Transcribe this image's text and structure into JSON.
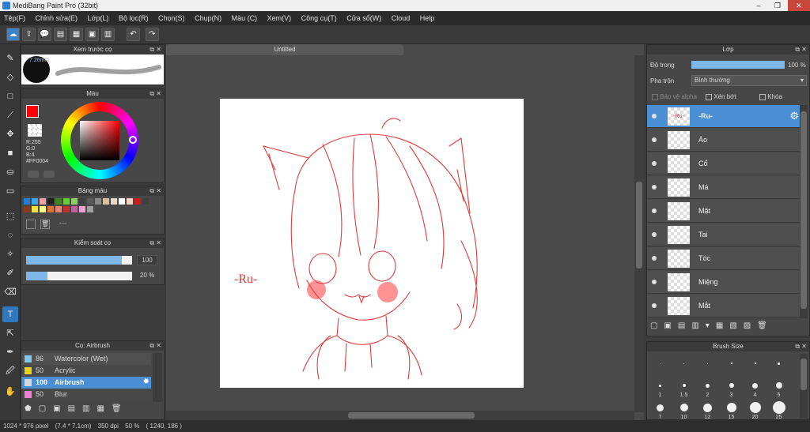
{
  "window": {
    "title": "MediBang Paint Pro (32bit)",
    "min": "–",
    "max": "❐",
    "close": "✕"
  },
  "menu": [
    "Tệp(F)",
    "Chỉnh sửa(E)",
    "Lớp(L)",
    "Bộ lọc(R)",
    "Chọn(S)",
    "Chụp(N)",
    "Màu (C)",
    "Xem(V)",
    "Công cụ(T)",
    "Cửa sổ(W)",
    "Cloud",
    "Help"
  ],
  "document": {
    "tab_title": "Untitled",
    "signature": "-Ru-"
  },
  "panels": {
    "brush_preview": {
      "title": "Xem trước cọ",
      "size_label": "7.26mm"
    },
    "color": {
      "title": "Màu",
      "r": "R:255",
      "g": "G:0",
      "b": "B:4",
      "hex": "#FF0004",
      "current": "#ff0004"
    },
    "palette": {
      "title": "Bảng màu",
      "dots": "----"
    },
    "brush_control": {
      "title": "Kiểm soát cọ",
      "size_value": "100",
      "opacity_value": "20 %",
      "size_fraction": 0.9,
      "opacity_fraction": 0.2
    },
    "brush_list": {
      "title": "Cọ: Airbrush",
      "items": [
        {
          "size": "86",
          "name": "Watercolor (Wet)",
          "color": "#7ec8f0"
        },
        {
          "size": "50",
          "name": "Acrylic",
          "color": "#e8d21c"
        },
        {
          "size": "100",
          "name": "Airbrush",
          "color": "#d8d8d8",
          "selected": true
        },
        {
          "size": "50",
          "name": "Blur",
          "color": "#f07ed8"
        }
      ]
    },
    "layers": {
      "title": "Lớp",
      "opacity_label": "Độ trong",
      "opacity_value": "100 %",
      "blend_label": "Pha trộn",
      "blend_value": "Bình thường",
      "protect_alpha": "Bảo vệ alpha",
      "clipping": "Xén bớt",
      "lock": "Khóa",
      "items": [
        {
          "name": "-Ru-",
          "selected": true
        },
        {
          "name": "Áo"
        },
        {
          "name": "Cổ"
        },
        {
          "name": "Má"
        },
        {
          "name": "Mặt"
        },
        {
          "name": "Tai"
        },
        {
          "name": "Tóc"
        },
        {
          "name": "Miệng"
        },
        {
          "name": "Mắt"
        }
      ]
    },
    "brush_size": {
      "title": "Brush Size",
      "labels": [
        ".",
        ".",
        ".",
        ".",
        ".",
        ".",
        "1",
        "1.5",
        "2",
        "3",
        "4",
        "5",
        "7",
        "10",
        "12",
        "15",
        "20",
        "25"
      ]
    }
  },
  "status": {
    "size": "1024 * 976 pixel",
    "dims": "(7.4 * 7.1cm)",
    "dpi": "350 dpi",
    "zoom": "50 %",
    "coords": "( 1240, 186 )"
  },
  "palette_colors": [
    "#1e7fd8",
    "#3aa8e8",
    "#f0a0a0",
    "#202020",
    "#3a8a20",
    "#66cc33",
    "#90d060",
    "#404040",
    "#5a5a5a",
    "#8a8a8a",
    "#d8c0a0",
    "#e8d8c8",
    "#ffffff",
    "#f8d0c0",
    "#d01818",
    "#404040",
    "#8a3a1a",
    "#f0e040",
    "#ffff80",
    "#e07030",
    "#f08070",
    "#c03030",
    "#c060a0",
    "#f0a0d0",
    "#a0a0a0"
  ],
  "colors": {
    "accent": "#4a8fd4",
    "brush_color": "#ff0004",
    "draw_red": "#e23a3a"
  }
}
